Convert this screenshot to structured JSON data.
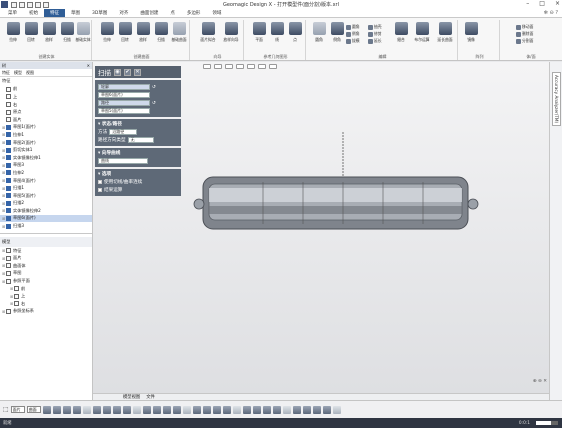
{
  "window": {
    "title": "Geomagic Design X - 打开模型件(面分割)版本.xrl",
    "controls": [
      "–",
      "□",
      "×"
    ]
  },
  "ribbon_tabs": [
    "菜单",
    "初始",
    "特征",
    "草图",
    "3D草图",
    "对齐",
    "曲面创建",
    "点",
    "多边形",
    "领域"
  ],
  "ribbon_active_tab": 2,
  "ribbon_right": "✻ ⊖ ?",
  "ribbon_groups": [
    {
      "label": "创建实体",
      "buttons": [
        "拉伸",
        "回转",
        "放样",
        "扫描",
        "基础实体"
      ]
    },
    {
      "label": "创建曲面",
      "buttons": [
        "拉伸",
        "回转",
        "放样",
        "扫描",
        "基础曲面"
      ]
    },
    {
      "label": "向导",
      "buttons": [
        "面片拟合",
        "放样向导"
      ]
    },
    {
      "label": "参考几何图形",
      "buttons": [
        "平面",
        "线",
        "点"
      ]
    },
    {
      "label": "编辑",
      "buttons": [
        "圆角",
        "倒角",
        "拔模",
        "抽壳",
        "缝合",
        "布尔运算",
        "延长曲面"
      ],
      "small": [
        "圆角",
        "倒角",
        "拔模",
        "抽壳",
        "修剪",
        "延长"
      ]
    },
    {
      "label": "阵列",
      "buttons": [
        "镜像"
      ]
    },
    {
      "label": "体/面",
      "small": [
        "移动面",
        "删除面",
        "分割面"
      ]
    }
  ],
  "left_panel": {
    "header": "树",
    "subtabs": [
      "特征",
      "模型",
      "视图"
    ],
    "tree_title": "特征",
    "tree": [
      {
        "label": "前",
        "sel": false
      },
      {
        "label": "上",
        "sel": false
      },
      {
        "label": "右",
        "sel": false
      },
      {
        "label": "原点",
        "sel": false
      },
      {
        "label": "面片",
        "sel": false
      },
      {
        "label": "草图1(面片)",
        "sel": false
      },
      {
        "label": "拉伸1",
        "sel": false
      },
      {
        "label": "草图2(面片)",
        "sel": false
      },
      {
        "label": "剪切实体1",
        "sel": false
      },
      {
        "label": "实体镜像拉伸1",
        "sel": false
      },
      {
        "label": "草图3",
        "sel": false
      },
      {
        "label": "拉伸2",
        "sel": false
      },
      {
        "label": "草图4(面片)",
        "sel": false
      },
      {
        "label": "扫描1",
        "sel": false
      },
      {
        "label": "草图5(面片)",
        "sel": false
      },
      {
        "label": "扫描2",
        "sel": false
      },
      {
        "label": "实体镜像拉伸2",
        "sel": false
      },
      {
        "label": "草图6(面片)",
        "sel": true
      },
      {
        "label": "扫描3",
        "sel": false
      }
    ],
    "bottom_header": "模型",
    "bottom_tree": [
      {
        "label": "特征"
      },
      {
        "label": "面片"
      },
      {
        "label": "曲面体"
      },
      {
        "label": "草图"
      },
      {
        "label": "参照平面"
      },
      {
        "label": "前"
      },
      {
        "label": "上"
      },
      {
        "label": "右"
      },
      {
        "label": "参照坐标系"
      }
    ]
  },
  "command_panel": {
    "title": "扫描",
    "ok_icon": "✔",
    "cancel_icon": "✕",
    "sections": [
      {
        "name": "required",
        "rows": [
          {
            "label": "轮廓",
            "value": "轮廓"
          },
          {
            "label": "",
            "value": "草图6(面片)"
          },
          {
            "label": "路径",
            "value": "路径"
          },
          {
            "label": "",
            "value": "草图5(面片)"
          }
        ]
      },
      {
        "name": "状态/路径",
        "method_label": "方法",
        "method_value": "沿路径",
        "dir_label": "路径方向类型",
        "dir_value": "无"
      },
      {
        "name": "向导曲线",
        "field_value": "曲线"
      },
      {
        "name": "选项",
        "options": [
          "使用切线/曲率连续",
          "结果运算"
        ]
      }
    ]
  },
  "viewport_tabs": [
    "模型视图",
    "文件"
  ],
  "viewport_zoom": "⊕ ⊖ ✕",
  "right_panel_label": "Accuracy Analyzer(TM)",
  "bottom_toolbar": {
    "select_label": "面片",
    "filter_label": "曲面"
  },
  "status": {
    "left": "就绪",
    "progress": 0.7,
    "right_text": "0:0:1"
  },
  "colors": {
    "active_tab": "#2f5d96",
    "panel_header": "#56606e",
    "section": "#5e6977",
    "selection": "#c6d6ee",
    "status_bg": "#2f3542"
  }
}
